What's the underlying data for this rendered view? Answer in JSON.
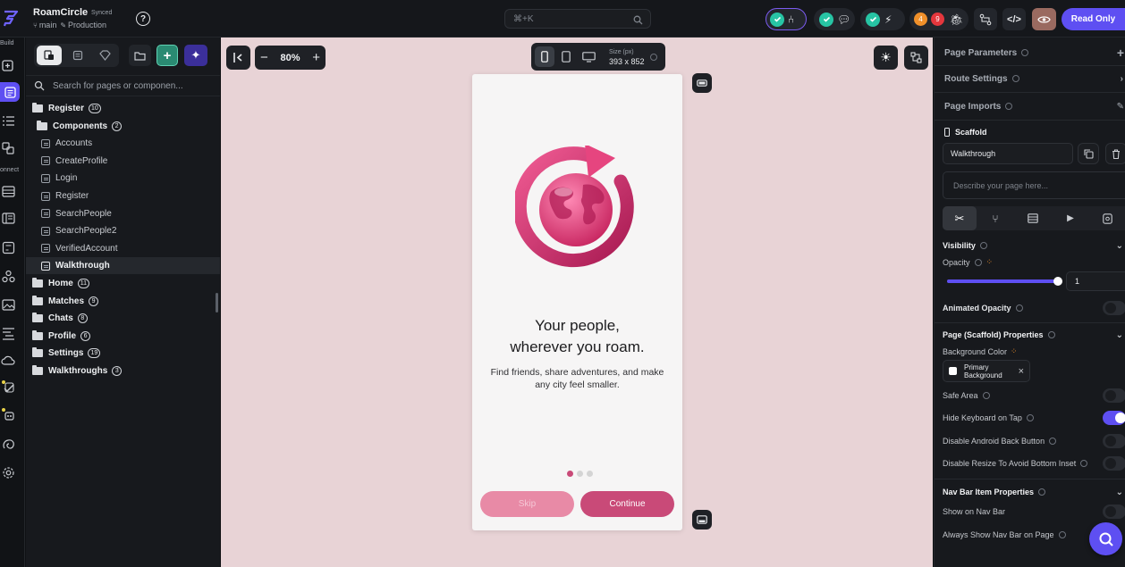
{
  "app": {
    "project_name": "RoamCircle",
    "sync_status": "Synced",
    "branch": "main",
    "environment": "Production",
    "search_shortcut": "⌘+K",
    "badge_orange": "4",
    "badge_red": "9",
    "read_only_label": "Read Only"
  },
  "rail": {
    "build_label": "Build",
    "connect_label": "onnect"
  },
  "nav": {
    "search_placeholder": "Search for pages or componen...",
    "tree": [
      {
        "label": "Register",
        "count": "10",
        "type": "folder-open"
      },
      {
        "label": "Components",
        "count": "2",
        "type": "folder"
      },
      {
        "label": "Accounts",
        "type": "page"
      },
      {
        "label": "CreateProfile",
        "type": "page"
      },
      {
        "label": "Login",
        "type": "page"
      },
      {
        "label": "Register",
        "type": "page"
      },
      {
        "label": "SearchPeople",
        "type": "page"
      },
      {
        "label": "SearchPeople2",
        "type": "page"
      },
      {
        "label": "VerifiedAccount",
        "type": "page"
      },
      {
        "label": "Walkthrough",
        "type": "page",
        "selected": true
      },
      {
        "label": "Home",
        "count": "11",
        "type": "folder"
      },
      {
        "label": "Matches",
        "count": "9",
        "type": "folder"
      },
      {
        "label": "Chats",
        "count": "8",
        "type": "folder"
      },
      {
        "label": "Profile",
        "count": "6",
        "type": "folder"
      },
      {
        "label": "Settings",
        "count": "19",
        "type": "folder"
      },
      {
        "label": "Walkthroughs",
        "count": "3",
        "type": "folder"
      }
    ]
  },
  "canvas": {
    "zoom": "80%",
    "size_label": "Size (px)",
    "size_value": "393 x 852",
    "phone": {
      "headline_line1": "Your people,",
      "headline_line2": "wherever you roam.",
      "subtitle": "Find friends, share adventures, and make any city feel smaller.",
      "skip_label": "Skip",
      "continue_label": "Continue",
      "page_index": 1,
      "page_count": 3
    }
  },
  "props": {
    "page_parameters": "Page Parameters",
    "route_settings": "Route Settings",
    "page_imports": "Page Imports",
    "scaffold_label": "Scaffold",
    "page_name_value": "Walkthrough",
    "describe_placeholder": "Describe your page here...",
    "visibility": "Visibility",
    "opacity_label": "Opacity",
    "opacity_value": "1",
    "animated_opacity": "Animated Opacity",
    "scaffold_props": "Page (Scaffold) Properties",
    "background_color": "Background Color",
    "bg_value_line1": "Primary",
    "bg_value_line2": "Background",
    "safe_area": "Safe Area",
    "hide_keyboard": "Hide Keyboard on Tap",
    "disable_android_back": "Disable Android Back Button",
    "disable_resize": "Disable Resize To Avoid Bottom Inset",
    "nav_bar_props": "Nav Bar Item Properties",
    "show_on_nav_bar": "Show on Nav Bar",
    "always_show_nav_bar": "Always Show Nav Bar on Page"
  },
  "colors": {
    "accent_purple": "#5e4ff2",
    "brand_pink": "#c94a78",
    "skip_pink": "#e88aa6",
    "canvas_bg": "#e8d3d6",
    "check_teal": "#27c4a4"
  }
}
